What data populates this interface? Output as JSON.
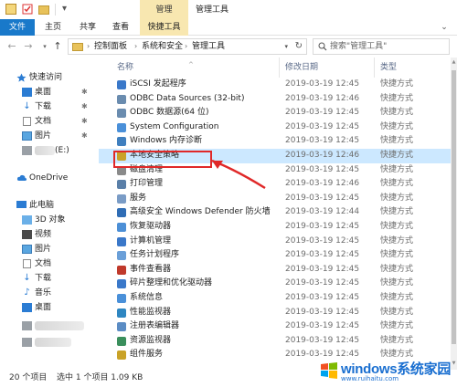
{
  "window": {
    "title": "管理工具",
    "context_tab_header": "管理"
  },
  "ribbon": {
    "tabs": [
      "文件",
      "主页",
      "共享",
      "查看",
      "快捷工具"
    ],
    "accent_color": "#1979ca",
    "context_color": "#f8e7b0"
  },
  "address": {
    "breadcrumb": [
      "控制面板",
      "系统和安全",
      "管理工具"
    ],
    "search_placeholder": "搜索\"管理工具\""
  },
  "navpane": {
    "quick_access": "快速访问",
    "quick_items": [
      {
        "label": "桌面",
        "icon": "desktop-icon",
        "pinned": true
      },
      {
        "label": "下载",
        "icon": "download-icon",
        "pinned": true
      },
      {
        "label": "文档",
        "icon": "documents-icon",
        "pinned": true
      },
      {
        "label": "图片",
        "icon": "pictures-icon",
        "pinned": true
      },
      {
        "label": "(E:)",
        "icon": "drive-icon",
        "pinned": false
      }
    ],
    "onedrive": "OneDrive",
    "this_pc": "此电脑",
    "pc_items": [
      {
        "label": "3D 对象",
        "icon": "objects-3d-icon"
      },
      {
        "label": "视频",
        "icon": "videos-icon"
      },
      {
        "label": "图片",
        "icon": "pictures-icon"
      },
      {
        "label": "文档",
        "icon": "documents-icon"
      },
      {
        "label": "下载",
        "icon": "download-icon"
      },
      {
        "label": "音乐",
        "icon": "music-icon"
      },
      {
        "label": "桌面",
        "icon": "desktop-icon"
      }
    ]
  },
  "columns": {
    "name": "名称",
    "date": "修改日期",
    "type": "类型"
  },
  "files": [
    {
      "name": "iSCSI 发起程序",
      "date": "2019-03-19 12:45",
      "type": "快捷方式"
    },
    {
      "name": "ODBC Data Sources (32-bit)",
      "date": "2019-03-19 12:46",
      "type": "快捷方式"
    },
    {
      "name": "ODBC 数据源(64 位)",
      "date": "2019-03-19 12:45",
      "type": "快捷方式"
    },
    {
      "name": "System Configuration",
      "date": "2019-03-19 12:45",
      "type": "快捷方式"
    },
    {
      "name": "Windows 内存诊断",
      "date": "2019-03-19 12:45",
      "type": "快捷方式"
    },
    {
      "name": "本地安全策略",
      "date": "2019-03-19 12:46",
      "type": "快捷方式"
    },
    {
      "name": "磁盘清理",
      "date": "2019-03-19 12:45",
      "type": "快捷方式"
    },
    {
      "name": "打印管理",
      "date": "2019-03-19 12:46",
      "type": "快捷方式"
    },
    {
      "name": "服务",
      "date": "2019-03-19 12:45",
      "type": "快捷方式"
    },
    {
      "name": "高级安全 Windows Defender 防火墙",
      "date": "2019-03-19 12:44",
      "type": "快捷方式"
    },
    {
      "name": "恢复驱动器",
      "date": "2019-03-19 12:45",
      "type": "快捷方式"
    },
    {
      "name": "计算机管理",
      "date": "2019-03-19 12:45",
      "type": "快捷方式"
    },
    {
      "name": "任务计划程序",
      "date": "2019-03-19 12:45",
      "type": "快捷方式"
    },
    {
      "name": "事件查看器",
      "date": "2019-03-19 12:45",
      "type": "快捷方式"
    },
    {
      "name": "碎片整理和优化驱动器",
      "date": "2019-03-19 12:45",
      "type": "快捷方式"
    },
    {
      "name": "系统信息",
      "date": "2019-03-19 12:45",
      "type": "快捷方式"
    },
    {
      "name": "性能监视器",
      "date": "2019-03-19 12:45",
      "type": "快捷方式"
    },
    {
      "name": "注册表编辑器",
      "date": "2019-03-19 12:45",
      "type": "快捷方式"
    },
    {
      "name": "资源监视器",
      "date": "2019-03-19 12:45",
      "type": "快捷方式"
    },
    {
      "name": "组件服务",
      "date": "2019-03-19 12:45",
      "type": "快捷方式"
    }
  ],
  "selected_index": 5,
  "status": {
    "count": "20 个项目",
    "selected": "选中 1 个项目  1.09 KB"
  },
  "watermark": {
    "text": "windows系统家园",
    "sub": "www.ruihaitu.com"
  }
}
